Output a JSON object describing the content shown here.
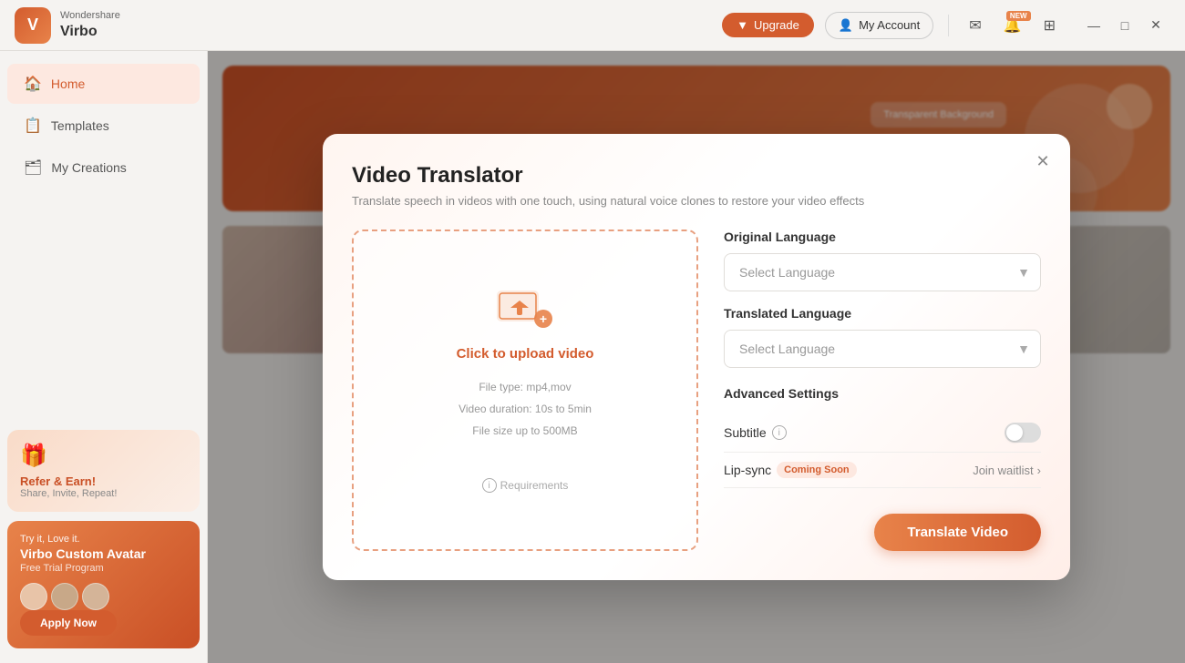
{
  "app": {
    "brand": "Wondershare",
    "product": "Virbo"
  },
  "titlebar": {
    "upgrade_label": "Upgrade",
    "my_account_label": "My Account",
    "new_badge": "NEW"
  },
  "sidebar": {
    "items": [
      {
        "id": "home",
        "label": "Home",
        "icon": "🏠",
        "active": true
      },
      {
        "id": "templates",
        "label": "Templates",
        "icon": "📋",
        "active": false
      },
      {
        "id": "my-creations",
        "label": "My Creations",
        "icon": "🗂",
        "active": false
      }
    ],
    "referral_card": {
      "title": "Refer & Earn!",
      "subtitle": "Share, Invite, Repeat!"
    },
    "trial_card": {
      "try_label": "Try it, Love it.",
      "product_name": "Virbo Custom Avatar",
      "program_label": "Free Trial Program",
      "apply_btn": "Apply Now"
    }
  },
  "modal": {
    "title": "Video Translator",
    "subtitle": "Translate speech in videos with one touch, using natural voice clones to restore your video effects",
    "upload": {
      "click_text": "Click to upload video",
      "file_type": "File type: mp4,mov",
      "duration": "Video duration: 10s to 5min",
      "file_size": "File size up to  500MB",
      "requirements": "Requirements"
    },
    "original_language_label": "Original Language",
    "original_language_placeholder": "Select Language",
    "translated_language_label": "Translated Language",
    "translated_language_placeholder": "Select Language",
    "advanced_settings_label": "Advanced Settings",
    "subtitle_label": "Subtitle",
    "lipsync_label": "Lip-sync",
    "coming_soon": "Coming Soon",
    "join_waitlist": "Join waitlist",
    "translate_btn": "Translate Video"
  }
}
